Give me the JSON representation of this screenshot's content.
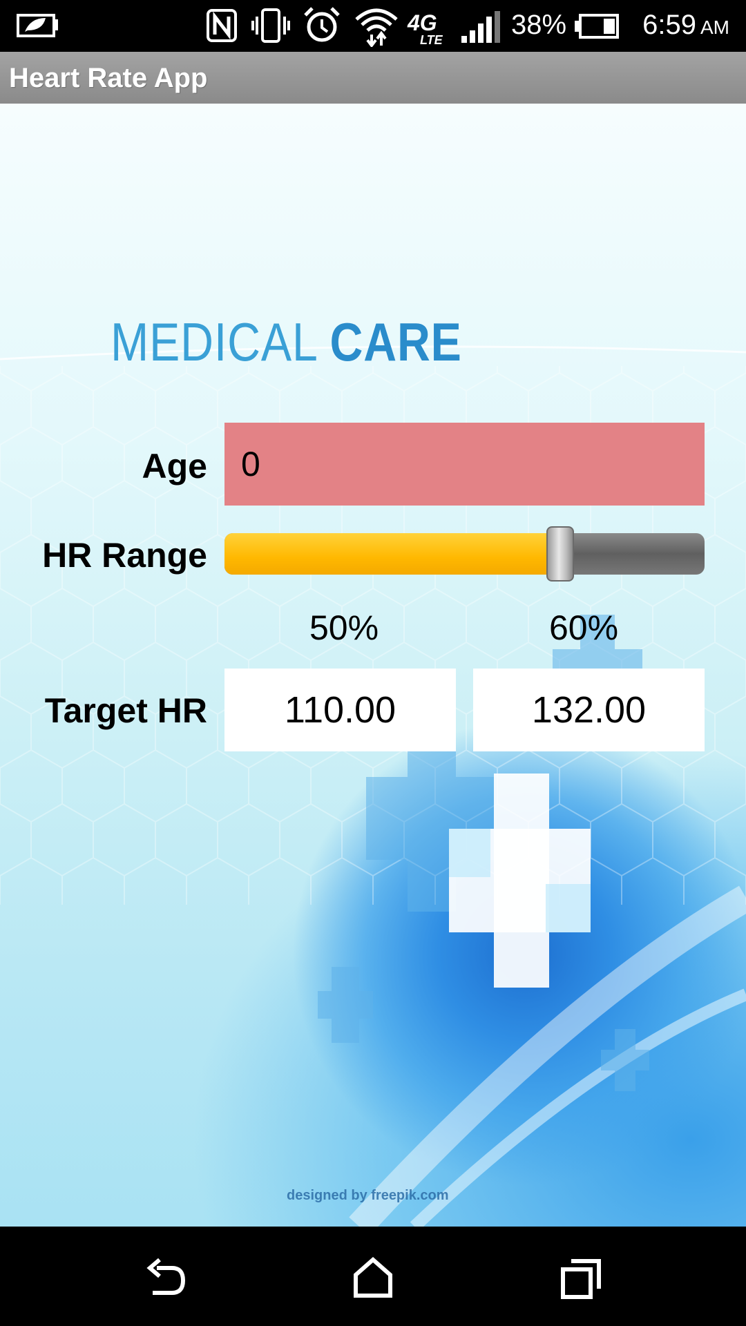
{
  "status_bar": {
    "battery_percent": "38%",
    "time": "6:59",
    "ampm": "AM",
    "network": "4G LTE",
    "icons": [
      "eco-battery-icon",
      "nfc-icon",
      "vibrate-icon",
      "alarm-icon",
      "wifi-icon",
      "lte-icon",
      "signal-icon",
      "battery-icon"
    ]
  },
  "action_bar": {
    "title": "Heart Rate App"
  },
  "brand": {
    "word1": "MEDICAL",
    "word2": "CARE"
  },
  "form": {
    "age_label": "Age",
    "age_value": "0",
    "hr_range_label": "HR Range",
    "hr_range_slider_fraction": 0.7,
    "low_pct": "50%",
    "high_pct": "60%",
    "target_hr_label": "Target HR",
    "target_low": "110.00",
    "target_high": "132.00"
  },
  "credit": "designed by freepik.com",
  "colors": {
    "age_field": "#e38286",
    "slider_fill": "#ffbd00",
    "action_bar": "#959595"
  },
  "nav_bar": {
    "icons": [
      "back-icon",
      "home-icon",
      "recents-icon"
    ]
  }
}
